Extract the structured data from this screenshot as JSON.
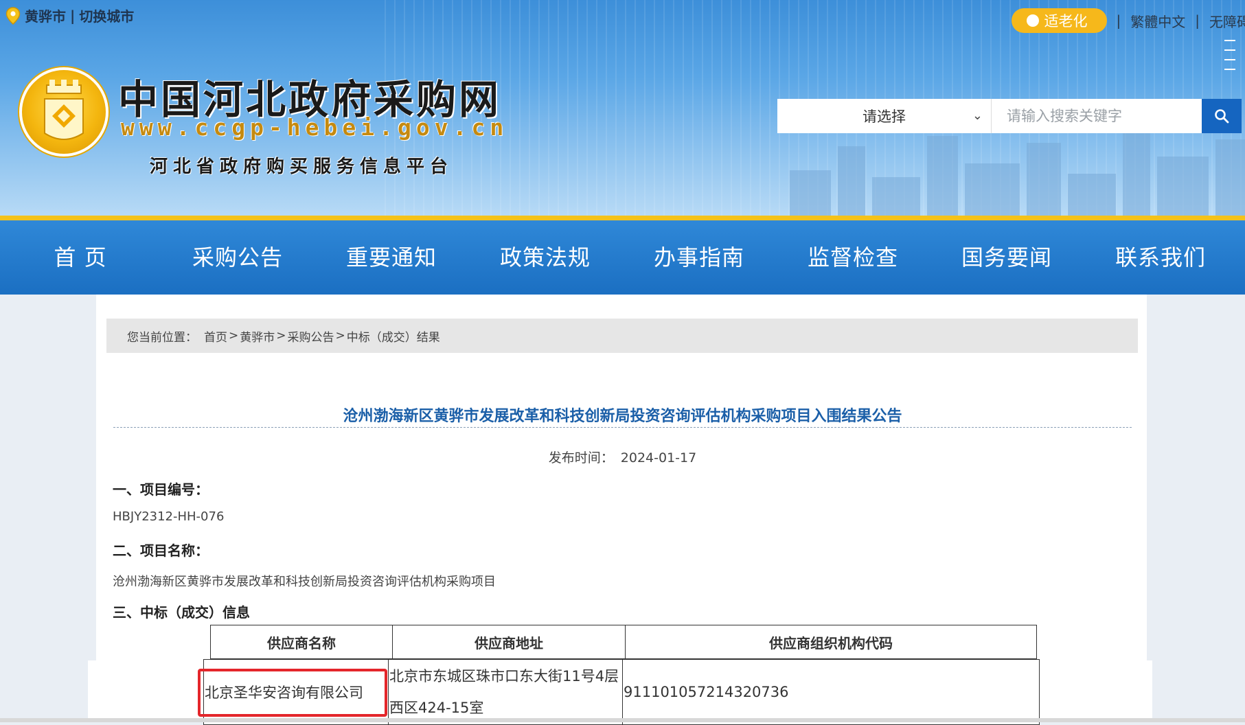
{
  "location": {
    "city": "黄骅市",
    "separator": "|",
    "switch_label": "切换城市"
  },
  "top_links": {
    "elder_mode": "适老化",
    "traditional": "繁體中文",
    "accessibility": "无障碍",
    "separator": "|"
  },
  "site": {
    "title": "中国河北政府采购网",
    "url": "www.ccgp-hebei.gov.cn",
    "subtitle": "河北省政府购买服务信息平台"
  },
  "search": {
    "select_value": "请选择",
    "placeholder": "请输入搜索关键字"
  },
  "nav": [
    "首 页",
    "采购公告",
    "重要通知",
    "政策法规",
    "办事指南",
    "监督检查",
    "国务要闻",
    "联系我们"
  ],
  "breadcrumb": {
    "label": "您当前位置：",
    "items": [
      "首页",
      "黄骅市",
      "采购公告",
      "中标（成交）结果"
    ],
    "separator": ">"
  },
  "article": {
    "title": "沧州渤海新区黄骅市发展改革和科技创新局投资咨询评估机构采购项目入围结果公告",
    "publish_label": "发布时间：",
    "publish_date": "2024-01-17",
    "sections": [
      {
        "heading": "一、项目编号：",
        "value": "HBJY2312-HH-076"
      },
      {
        "heading": "二、项目名称：",
        "value": "沧州渤海新区黄骅市发展改革和科技创新局投资咨询评估机构采购项目"
      },
      {
        "heading": "三、中标（成交）信息"
      }
    ],
    "table": {
      "headers": [
        "供应商名称",
        "供应商地址",
        "供应商组织机构代码"
      ],
      "rows": [
        {
          "name": "北京圣华安咨询有限公司",
          "address": "北京市东城区珠市口东大街11号4层西区424-15室",
          "code": "911101057214320736"
        }
      ]
    }
  },
  "colors": {
    "nav_bg": "#1b6fc2",
    "accent_gold": "#f4c21a",
    "title_blue": "#1b5fa8",
    "highlight_red": "#e4262b"
  }
}
